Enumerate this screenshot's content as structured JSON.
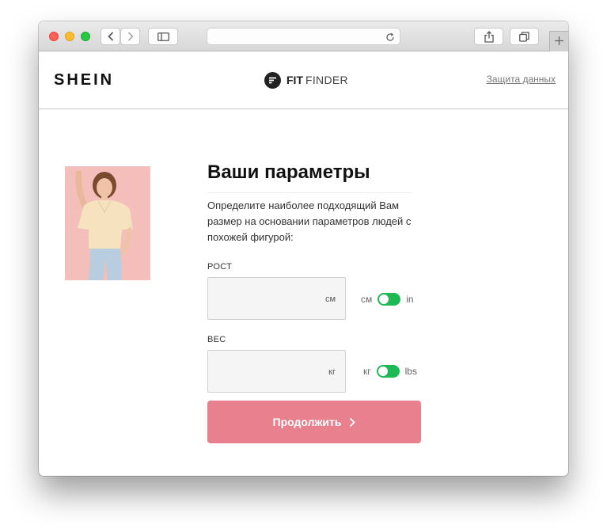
{
  "header": {
    "logo": "SHEIN",
    "fit_finder_bold": "FIT",
    "fit_finder_light": "FINDER",
    "privacy_link": "Защита данных"
  },
  "form": {
    "title": "Ваши параметры",
    "description": "Определите наиболее подходящий Вам размер на основании параметров людей с похожей фигурой:",
    "height": {
      "label": "РОСТ",
      "value": "",
      "unit": "см",
      "toggle_left": "см",
      "toggle_right": "in"
    },
    "weight": {
      "label": "ВЕС",
      "value": "",
      "unit": "кг",
      "toggle_left": "кг",
      "toggle_right": "lbs"
    },
    "continue_label": "Продолжить"
  },
  "colors": {
    "accent_button": "#e8808d",
    "toggle_on": "#1db954"
  },
  "icons": {
    "back": "chevron-left-icon",
    "forward": "chevron-right-icon",
    "sidebar": "sidebar-icon",
    "reload": "reload-icon",
    "share": "share-icon",
    "tabs": "tabs-icon",
    "new_tab": "plus-icon"
  }
}
